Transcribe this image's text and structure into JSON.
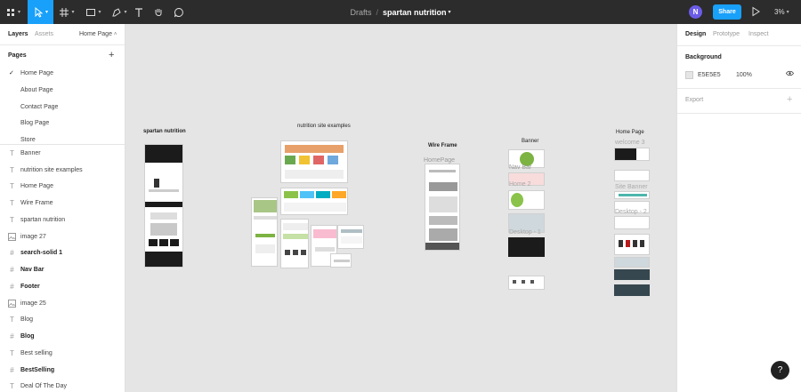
{
  "toolbar": {
    "breadcrumb_folder": "Drafts",
    "breadcrumb_sep": "/",
    "file_name": "spartan nutrition",
    "avatar_initial": "N",
    "share_label": "Share",
    "zoom_label": "3%"
  },
  "left_panel": {
    "tab_layers": "Layers",
    "tab_assets": "Assets",
    "current_page_selector": "Home Page",
    "pages_heading": "Pages",
    "pages": [
      "Home Page",
      "About Page",
      "Contact Page",
      "Blog Page",
      "Store"
    ],
    "layers": [
      {
        "name": "Banner",
        "icon": "text"
      },
      {
        "name": "nutrition site examples",
        "icon": "text"
      },
      {
        "name": "Home Page",
        "icon": "text"
      },
      {
        "name": "Wire Frame",
        "icon": "text"
      },
      {
        "name": "spartan nutrition",
        "icon": "text"
      },
      {
        "name": "image 27",
        "icon": "image"
      },
      {
        "name": "search-solid 1",
        "icon": "frame"
      },
      {
        "name": "Nav Bar",
        "icon": "frame"
      },
      {
        "name": "Footer",
        "icon": "frame"
      },
      {
        "name": "image 25",
        "icon": "image"
      },
      {
        "name": "Blog",
        "icon": "text"
      },
      {
        "name": "Blog",
        "icon": "frame"
      },
      {
        "name": "Best selling",
        "icon": "text"
      },
      {
        "name": "BestSelling",
        "icon": "frame"
      },
      {
        "name": "Deal Of The Day",
        "icon": "text"
      }
    ]
  },
  "right_panel": {
    "tab_design": "Design",
    "tab_prototype": "Prototype",
    "tab_inspect": "Inspect",
    "background_label": "Background",
    "background_hex": "E5E5E5",
    "background_opacity": "100%",
    "export_label": "Export"
  },
  "canvas": {
    "frame_labels": {
      "spartan": "spartan nutrition",
      "examples": "nutrition site examples",
      "wireframe": "Wire Frame",
      "banner": "Banner",
      "homepage": "Home Page"
    },
    "ghost_labels": {
      "wf_homepage": "HomePage",
      "banner_navbar": "Nav Bar",
      "banner_home2": "Home 2",
      "banner_desktop": "Desktop - 1",
      "home_welcome": "welcome 3",
      "home_site_banner": "Site Banner",
      "home_desktop": "Desktop - 2"
    }
  },
  "help_label": "?",
  "colors": {
    "accent": "#18a0fb",
    "toolbar_bg": "#2c2c2c",
    "canvas_bg": "#e5e5e5",
    "avatar": "#6b5ce7"
  }
}
